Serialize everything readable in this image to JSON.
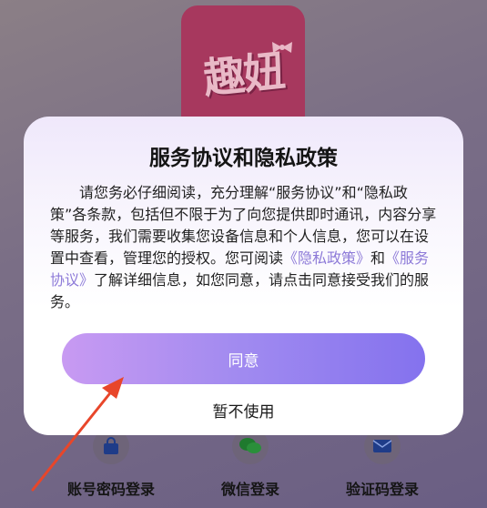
{
  "background": {
    "logo_text": "趣妞",
    "login_options": [
      {
        "label": "账号密码登录",
        "icon": "lock-icon"
      },
      {
        "label": "微信登录",
        "icon": "wechat-icon"
      },
      {
        "label": "验证码登录",
        "icon": "envelope-icon"
      }
    ]
  },
  "dialog": {
    "title": "服务协议和隐私政策",
    "body_part1": "请您务必仔细阅读，充分理解“服务协议”和“隐私政策”各条款，包括但不限于为了向您提供即时通讯，内容分享等服务，我们需要收集您设备信息和个人信息，您可以在设置中查看，管理您的授权。您可阅读",
    "privacy_link": "《隐私政策》",
    "body_and": "和",
    "service_link": "《服务协议》",
    "body_part2": "了解详细信息，如您同意，请点击同意接受我们的服务。",
    "agree_label": "同意",
    "decline_label": "暂不使用"
  },
  "colors": {
    "accent_start": "#c89af2",
    "accent_end": "#8472ee",
    "link": "#8d7ad8",
    "annotation_arrow": "#e8462a"
  }
}
